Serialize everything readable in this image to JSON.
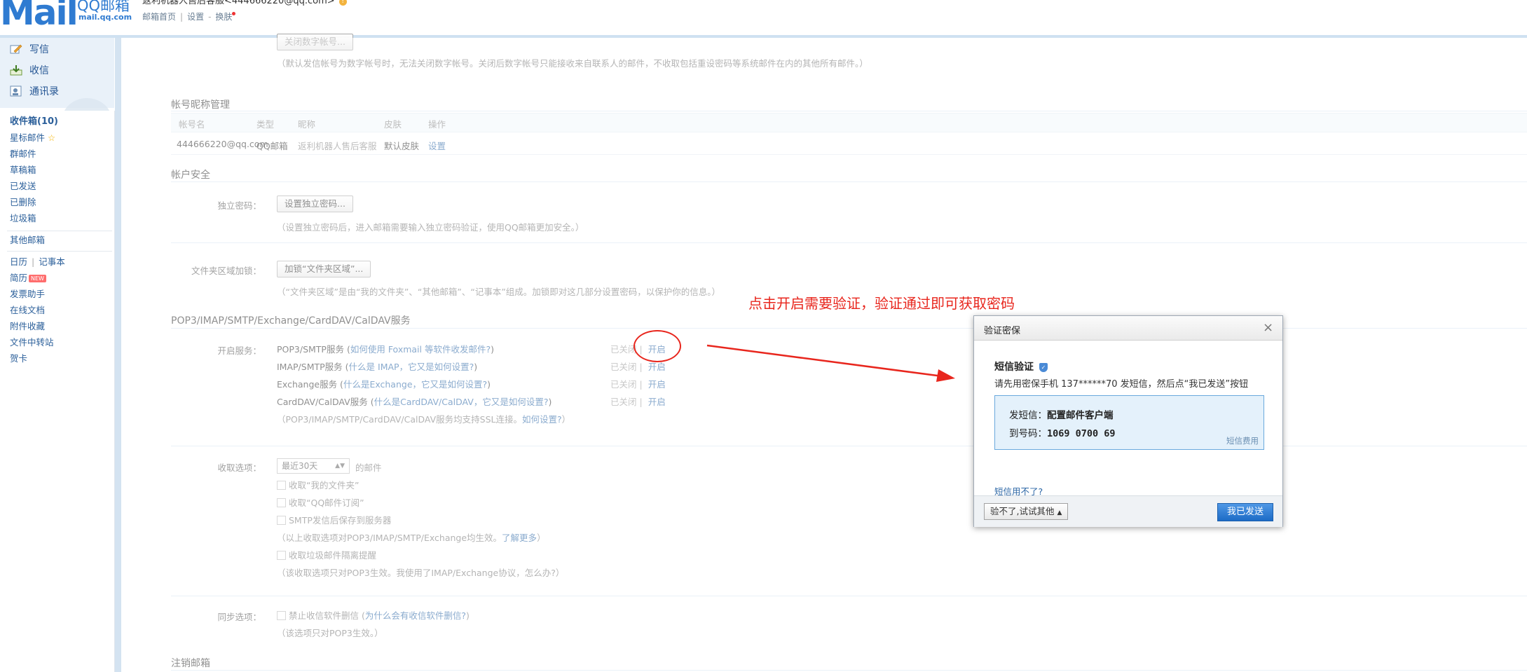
{
  "header": {
    "logo_text": "Mail",
    "logo_cn": "QQ邮箱",
    "logo_url": "mail.qq.com",
    "user_line": "返利机器人售后客服<444666220@qq.com>",
    "links": [
      "邮箱首页",
      "设置",
      "换肤"
    ]
  },
  "sidebar": {
    "main": [
      {
        "label": "写信",
        "icon": "compose-icon"
      },
      {
        "label": "收信",
        "icon": "inbox-icon"
      },
      {
        "label": "通讯录",
        "icon": "contacts-icon"
      }
    ],
    "folders": [
      "收件箱(10)",
      "星标邮件",
      "群邮件",
      "草稿箱",
      "已发送",
      "已删除",
      "垃圾箱"
    ],
    "other_mail": "其他邮箱",
    "calendar": "日历",
    "notes": "记事本",
    "extras": [
      "简历",
      "发票助手",
      "在线文档",
      "附件收藏",
      "文件中转站",
      "贺卡"
    ],
    "new_badge": "NEW"
  },
  "main": {
    "top_button": "关闭数字帐号...",
    "top_hint": "（默认发信帐号为数字帐号时，无法关闭数字帐号。关闭后数字帐号只能接收来自联系人的邮件，不收取包括重设密码等系统邮件在内的其他所有邮件。）",
    "nickname_section": "帐号昵称管理",
    "table_headers": [
      "帐号名",
      "类型",
      "昵称",
      "皮肤",
      "操作"
    ],
    "table_row": [
      "444666220@qq.com",
      "QQ邮箱",
      "返利机器人售后客服",
      "默认皮肤",
      "设置"
    ],
    "security_section": "帐户安全",
    "pwd_label": "独立密码：",
    "pwd_button": "设置独立密码...",
    "pwd_hint": "（设置独立密码后，进入邮箱需要输入独立密码验证，使用QQ邮箱更加安全。）",
    "folder_label": "文件夹区域加锁：",
    "folder_button": "加锁“文件夹区域”...",
    "folder_hint": "（“文件夹区域”是由“我的文件夹”、“其他邮箱”、“记事本”组成。加锁即对这几部分设置密码，以保护你的信息。）",
    "pop_section": "POP3/IMAP/SMTP/Exchange/CardDAV/CalDAV服务",
    "service_label": "开启服务：",
    "services": [
      {
        "name": "POP3/SMTP服务",
        "q": "如何使用 Foxmail 等软件收发邮件?"
      },
      {
        "name": "IMAP/SMTP服务",
        "q": "什么是 IMAP，它又是如何设置?"
      },
      {
        "name": "Exchange服务",
        "q": "什么是Exchange，它又是如何设置?"
      },
      {
        "name": "CardDAV/CalDAV服务",
        "q": "什么是CardDAV/CalDAV，它又是如何设置?"
      }
    ],
    "state_closed": "已关闭",
    "state_open": "开启",
    "ssl_hint": "（POP3/IMAP/SMTP/CardDAV/CalDAV服务均支持SSL连接。",
    "ssl_link": "如何设置?",
    "ssl_close": "）",
    "recv_label": "收取选项：",
    "recv_select": "最近30天",
    "recv_suffix": "的邮件",
    "recv_opts": [
      "收取“我的文件夹”",
      "收取“QQ邮件订阅”",
      "SMTP发信后保存到服务器"
    ],
    "recv_hint": "（以上收取选项对POP3/IMAP/SMTP/Exchange均生效。",
    "recv_more": "了解更多",
    "recv_hint_close": "）",
    "recv_spam": "收取垃圾邮件隔离提醒",
    "recv_hint2": "（该收取选项只对POP3生效。我使用了IMAP/Exchange协议，怎么办?）",
    "sync_label": "同步选项：",
    "sync_opt": "禁止收信软件删信",
    "sync_q": "为什么会有收信软件删信?",
    "sync_hint": "（该选项只对POP3生效。）",
    "cancel_section": "注销邮箱"
  },
  "annotation": {
    "text": "点击开启需要验证，验证通过即可获取密码",
    "color": "#e8261d"
  },
  "dialog": {
    "title": "验证密保",
    "heading": "短信验证",
    "desc": "请先用密保手机 137******70 发短信，然后点“我已发送”按钮",
    "sms_label": "发短信：",
    "sms_content": "配置邮件客户端",
    "to_label": "到号码：",
    "to_number": "1069 0700 69",
    "fee": "短信费用",
    "fail_link": "短信用不了?",
    "alt_button": "验不了,试试其他",
    "ok_button": "我已发送"
  }
}
